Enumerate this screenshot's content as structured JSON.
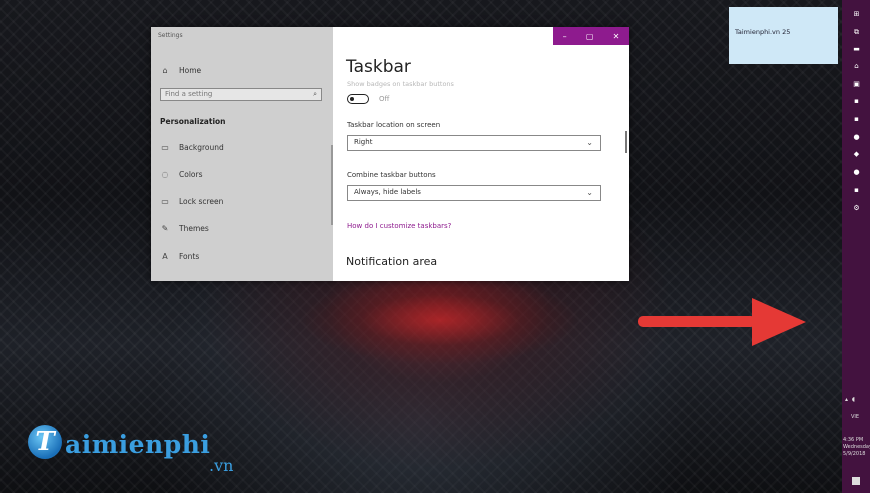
{
  "settings": {
    "app_title": "Settings",
    "home_label": "Home",
    "search_placeholder": "Find a setting",
    "section_heading": "Personalization",
    "nav_items": [
      {
        "label": "Background",
        "icon": "picture-icon"
      },
      {
        "label": "Colors",
        "icon": "palette-icon"
      },
      {
        "label": "Lock screen",
        "icon": "lock-screen-icon"
      },
      {
        "label": "Themes",
        "icon": "brush-icon"
      },
      {
        "label": "Fonts",
        "icon": "font-icon"
      }
    ],
    "window_controls": {
      "minimize": "–",
      "maximize": "▢",
      "close": "✕"
    },
    "page_title": "Taskbar",
    "faded_option": "Show badges on taskbar buttons",
    "toggle_state": "Off",
    "location_label": "Taskbar location on screen",
    "location_value": "Right",
    "combine_label": "Combine taskbar buttons",
    "combine_value": "Always, hide labels",
    "customize_link": "How do I customize taskbars?",
    "notification_heading": "Notification area"
  },
  "toast": {
    "text": "Taimienphi.vn 25"
  },
  "taskbar": {
    "position": "right",
    "tray_lang": "VIE",
    "clock_time": "4:36 PM",
    "clock_day": "Wednesday",
    "clock_date": "5/9/2018"
  },
  "logo": {
    "main": "aimienphi",
    "initial": "T",
    "tld": ".vn"
  },
  "colors": {
    "accent": "#8e1b8e",
    "taskbar": "#43123f",
    "arrow": "#e53935",
    "logo": "#3a9ee0"
  }
}
